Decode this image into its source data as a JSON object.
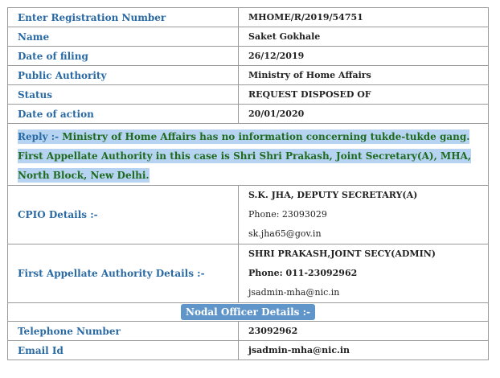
{
  "registration": {
    "label": "Enter Registration Number",
    "value": "MHOME/R/2019/54751"
  },
  "name": {
    "label": "Name",
    "value": "Saket Gokhale"
  },
  "filing": {
    "label": "Date of filing",
    "value": "26/12/2019"
  },
  "authority": {
    "label": "Public Authority",
    "value": "Ministry of Home Affairs"
  },
  "status": {
    "label": "Status",
    "value": "REQUEST DISPOSED OF"
  },
  "action": {
    "label": "Date of action",
    "value": "20/01/2020"
  },
  "reply": {
    "prefix": "Reply :-",
    "text": " Ministry of Home Affairs has no information concerning tukde-tukde gang.",
    "appellate_text": "First Appellate Authority in this case is Shri Shri Prakash, Joint Secretary(A), MHA, North Block, New Delhi."
  },
  "cpio": {
    "label": "CPIO Details :-",
    "name": "S.K. JHA, DEPUTY SECRETARY(A)",
    "phone": "Phone: 23093029",
    "email": "sk.jha65@gov.in"
  },
  "faa": {
    "label": "First Appellate Authority Details :-",
    "name": "SHRI PRAKASH,JOINT SECY(ADMIN)",
    "phone": "Phone: 011-23092962",
    "email": "jsadmin-mha@nic.in"
  },
  "nodal": {
    "title": "Nodal Officer Details :-"
  },
  "telephone": {
    "label": "Telephone Number",
    "value": "23092962"
  },
  "email": {
    "label": "Email Id",
    "value": "jsadmin-mha@nic.in"
  },
  "colors": {
    "label": "#2a6aa4",
    "highlight": "#b6d4f1",
    "reply_text": "#1f6a1f",
    "badge": "#5f95c8"
  }
}
